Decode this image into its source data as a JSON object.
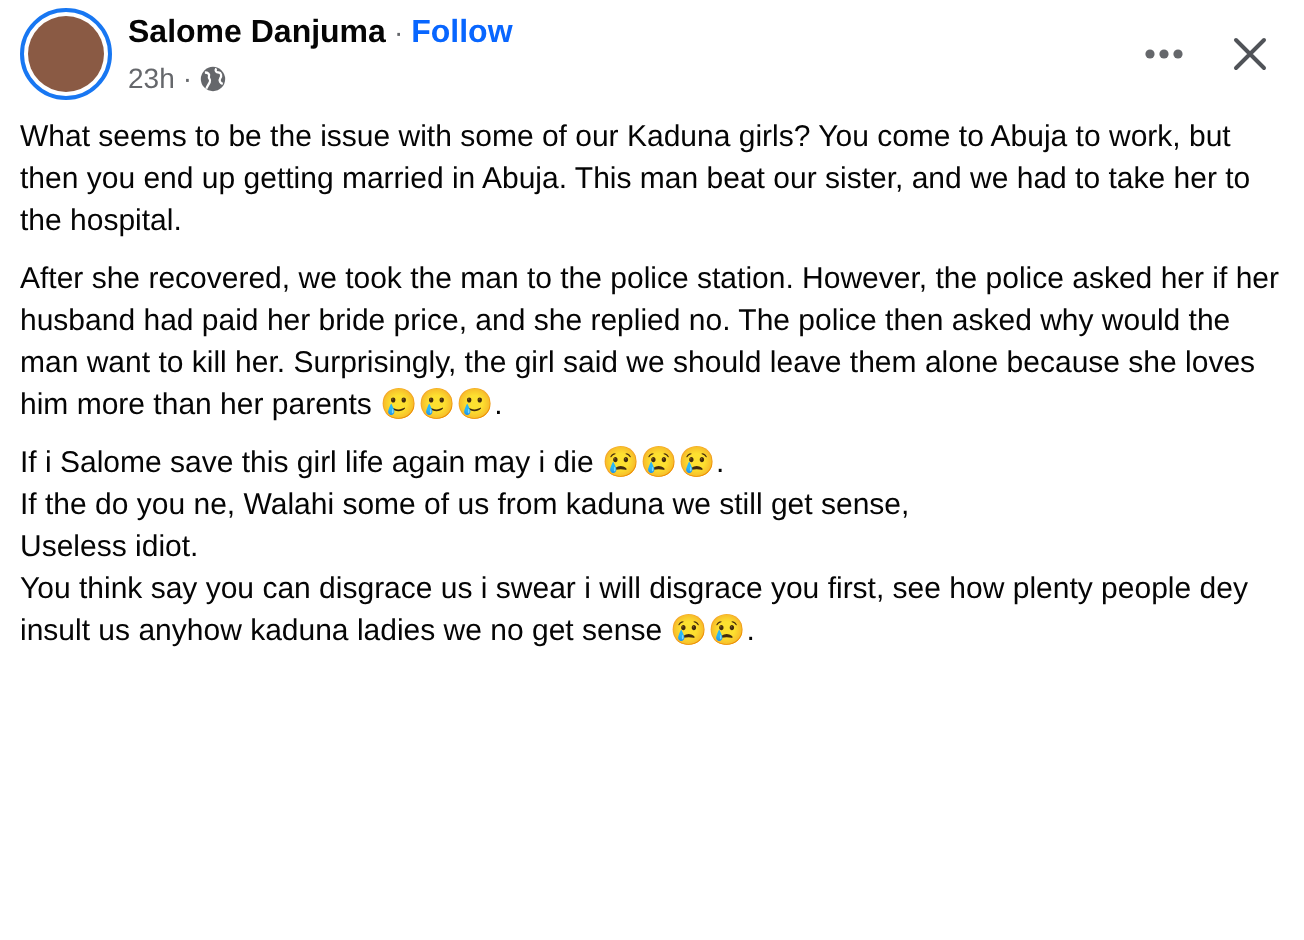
{
  "post": {
    "author": "Salome Danjuma",
    "separator": "·",
    "follow": "Follow",
    "time": "23h",
    "time_separator": "·"
  },
  "paragraphs": [
    {
      "lines": [
        "What seems to be the issue with some of our Kaduna girls? You come to Abuja to work, but then you end up getting married in Abuja. This man beat our sister, and we had to take her to the hospital."
      ]
    },
    {
      "lines": [
        "After she recovered, we took the man to the police station. However, the police asked her if her husband had paid her bride price, and she replied no. The police then asked why would the man want to kill her. Surprisingly, the girl said we should leave them alone because she loves him more than her parents 🥲🥲🥲."
      ]
    },
    {
      "lines": [
        "If i Salome save this girl life again may i die 😢😢😢.",
        "If the do you ne, Walahi some of us from kaduna we still get sense,",
        "Useless idiot.",
        "You think say you can disgrace us i swear i will disgrace you first, see how plenty people dey insult us anyhow kaduna ladies we no get sense 😢😢."
      ]
    }
  ]
}
